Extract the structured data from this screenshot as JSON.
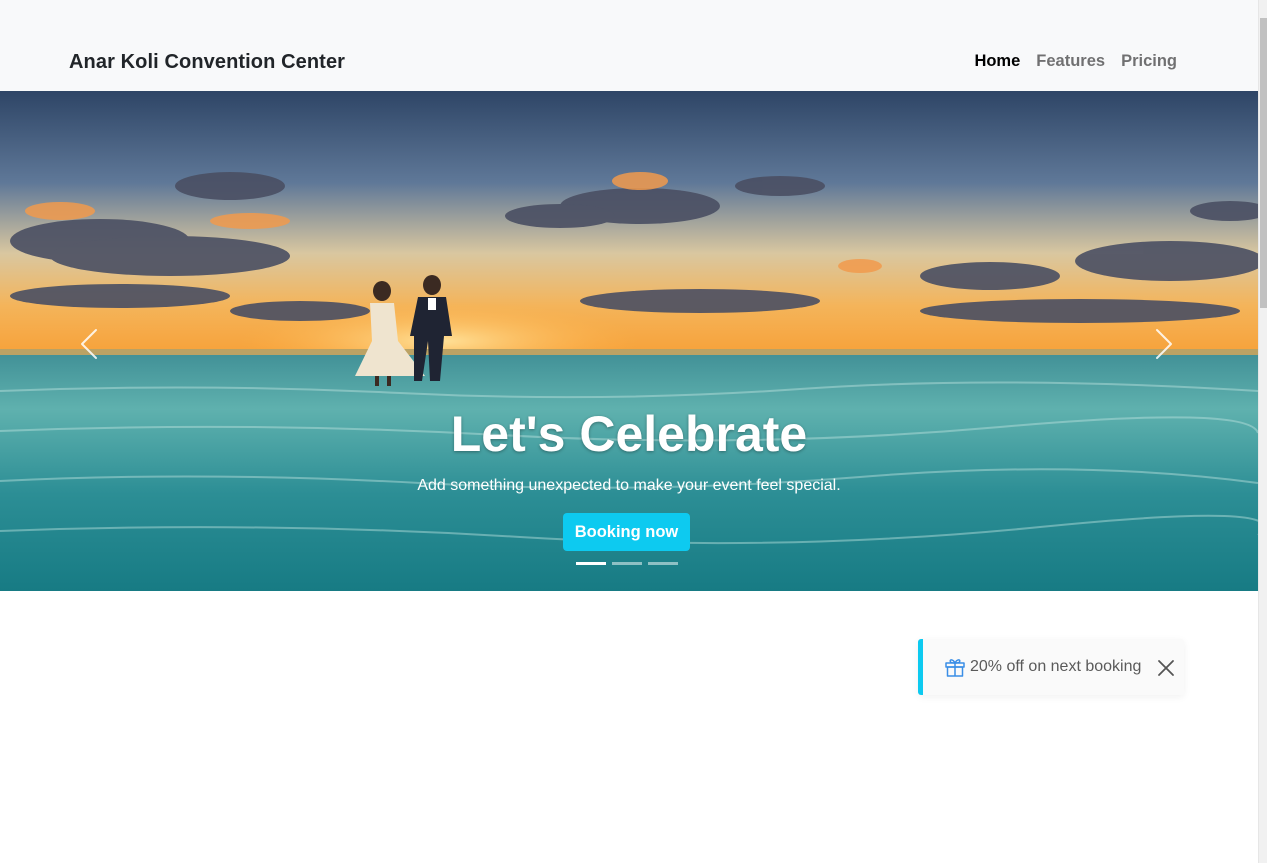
{
  "navbar": {
    "brand": "Anar Koli Convention Center",
    "links": [
      {
        "label": "Home",
        "active": true
      },
      {
        "label": "Features",
        "active": false
      },
      {
        "label": "Pricing",
        "active": false
      }
    ]
  },
  "carousel": {
    "title": "Let's Celebrate",
    "subtitle": "Add something unexpected to make your event feel special.",
    "button_label": "Booking now",
    "slide_count": 3,
    "active_slide": 1,
    "prev_icon": "chevron-left-icon",
    "next_icon": "chevron-right-icon"
  },
  "toast": {
    "icon": "gift-icon",
    "message": "20% off on next booking",
    "close_icon": "close-icon"
  },
  "colors": {
    "accent": "#0dcaf0",
    "navbar_bg": "#f8f9fa"
  }
}
